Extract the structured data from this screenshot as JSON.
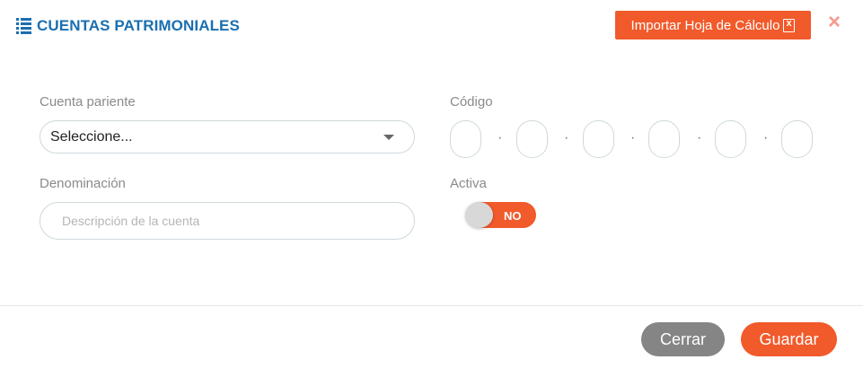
{
  "header": {
    "title": "CUENTAS PATRIMONIALES",
    "title_icon": "list-icon",
    "import_label": "Importar Hoja de Cálculo",
    "import_icon": "excel-file-icon",
    "close_symbol": "×"
  },
  "form": {
    "parent_label": "Cuenta pariente",
    "parent_value": "Seleccione...",
    "code_label": "Código",
    "code_separator": "·",
    "denomination_label": "Denominación",
    "denomination_placeholder": "Descripción de la cuenta",
    "active_label": "Activa",
    "active_value": "NO"
  },
  "footer": {
    "cancel_label": "Cerrar",
    "save_label": "Guardar"
  },
  "colors": {
    "accent": "#f15a2b",
    "title": "#1a6fb0",
    "secondary_button": "#858585"
  }
}
